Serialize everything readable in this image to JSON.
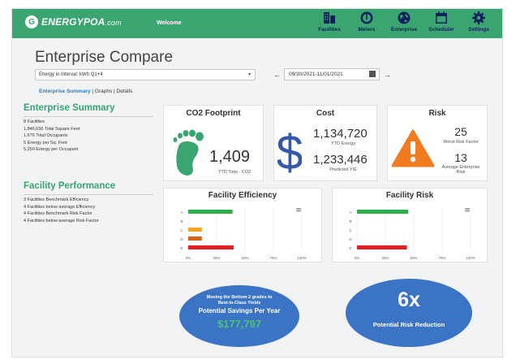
{
  "app": {
    "logo_mark": "G",
    "logo_text": "ENERGYPOA",
    "logo_suffix": ".com",
    "welcome": "Welcome"
  },
  "nav": [
    {
      "label": "Facilities",
      "icon": "buildings-icon"
    },
    {
      "label": "Meters",
      "icon": "gauge-icon"
    },
    {
      "label": "Enterprise",
      "icon": "globe-icon"
    },
    {
      "label": "Scheduler",
      "icon": "calendar-icon"
    },
    {
      "label": "Settings",
      "icon": "gear-icon"
    }
  ],
  "page": {
    "title": "Enterprise Compare"
  },
  "filter": {
    "metric": "Energy in Interval: kWh Q1+4",
    "date_range": "09/30/2021-11/01/2021",
    "prev": "←",
    "next": "→"
  },
  "tabs": {
    "summary": "Enterprise Summary",
    "sep1": " | ",
    "graphs": "Graphs",
    "sep2": " | ",
    "details": "Details"
  },
  "summary": {
    "title": "Enterprise Summary",
    "lines": [
      "8 Facilities",
      "1,846,656 Total Square Feet",
      "1,676 Total Occupants",
      "5 Energy per Sq. Foot",
      "5,250 Energy per Occupant"
    ]
  },
  "performance": {
    "title": "Facility Performance",
    "lines": [
      "3 Facilities Benchmark Efficiency",
      "4 Facilities below average Efficiency",
      "4 Facilities Benchmark Risk Factor",
      "4 Facilities below average Risk Factor"
    ]
  },
  "co2": {
    "title": "CO2 Footprint",
    "value": "1,409",
    "label": "YTD Tons - CO2"
  },
  "cost": {
    "title": "Cost",
    "ytd_value": "1,134,720",
    "ytd_label": "YTD Energy",
    "pred_value": "1,233,446",
    "pred_label": "Predicted Y/E"
  },
  "risk": {
    "title": "Risk",
    "worst_value": "25",
    "worst_label": "Worst Risk Factor",
    "avg_value": "13",
    "avg_label_1": "Average Enterprise",
    "avg_label_2": "Risk"
  },
  "colors": {
    "brand": "#3aa571",
    "blue": "#3c74c5",
    "savings": "#4cc071",
    "warning": "#f07b21",
    "footprint": "#3aa571",
    "dollar": "#3559a8"
  },
  "chart_data": [
    {
      "type": "bar",
      "title": "Facility Efficiency",
      "categories": [
        "A",
        "B",
        "C",
        "D",
        "E"
      ],
      "values": [
        39,
        0,
        12,
        12,
        40
      ],
      "bar_colors": [
        "#2eae4a",
        "#2eae4a",
        "#f5a623",
        "#d4651a",
        "#e02020"
      ],
      "xticks": [
        "0%",
        "25%",
        "50%",
        "75%",
        "100%"
      ],
      "xlim": [
        0,
        100
      ],
      "menu_icon": "≡"
    },
    {
      "type": "bar",
      "title": "Facility Risk",
      "categories": [
        "A",
        "B",
        "C",
        "D",
        "E"
      ],
      "values": [
        45,
        0,
        0,
        0,
        44
      ],
      "bar_colors": [
        "#2eae4a",
        "#2eae4a",
        "#f5a623",
        "#d4651a",
        "#e02020"
      ],
      "xticks": [
        "0%",
        "25%",
        "50%",
        "75%",
        "100%"
      ],
      "xlim": [
        0,
        100
      ],
      "menu_icon": "≡"
    }
  ],
  "savings": {
    "line1": "Moving the Bottom 2 grades to",
    "line2": "Best-in-Class Yields",
    "title": "Potential Savings Per Year",
    "value": "$177,797"
  },
  "risk_reduction": {
    "value": "6x",
    "label": "Potential Risk Reduction"
  }
}
